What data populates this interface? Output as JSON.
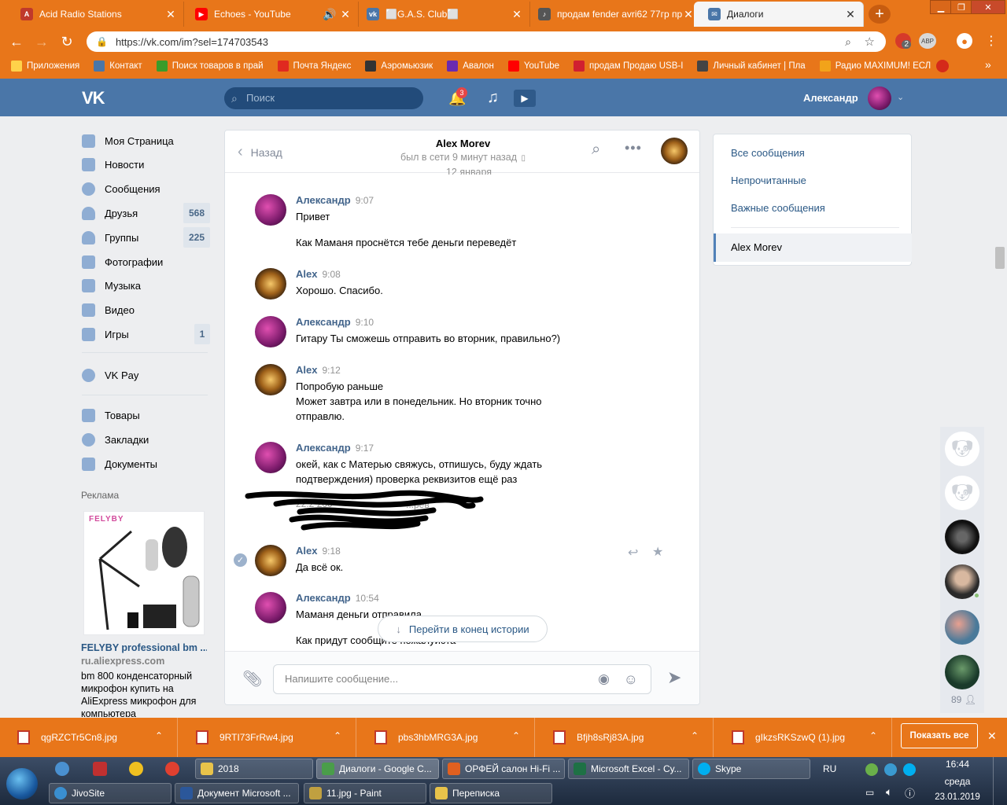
{
  "browser": {
    "tabs": [
      {
        "title": "Acid Radio Stations",
        "icon": "acid-radio-icon",
        "color": "#c0392b"
      },
      {
        "title": "Echoes - YouTube",
        "icon": "youtube-icon",
        "color": "#ff0000"
      },
      {
        "title": "⬜G.A.S. Club⬜",
        "icon": "vk-icon",
        "color": "#4a76a8"
      },
      {
        "title": "продам fender avri62 77гр пр...",
        "icon": "guitar-icon",
        "color": "#555555"
      },
      {
        "title": "Диалоги",
        "icon": "vk-dialog-icon",
        "color": "#4a76a8",
        "active": true
      }
    ],
    "url": "https://vk.com/im?sel=174703543",
    "extension_badge": "2",
    "extension_label": "АВР",
    "bookmarks": [
      {
        "label": "Приложения",
        "icon": "apps-grid-icon",
        "color": "#ffd24a"
      },
      {
        "label": "Контакт",
        "icon": "vk-icon",
        "color": "#4a76a8"
      },
      {
        "label": "Поиск товаров в прай",
        "icon": "leaf-icon",
        "color": "#3a9c2a"
      },
      {
        "label": "Почта Яндекс",
        "icon": "yandex-icon",
        "color": "#e02a20"
      },
      {
        "label": "Аэромьюзик",
        "icon": "aeromusic-icon",
        "color": "#333333"
      },
      {
        "label": "Авалон",
        "icon": "avalon-icon",
        "color": "#6a2ab0"
      },
      {
        "label": "YouTube",
        "icon": "youtube-icon",
        "color": "#ff0000"
      },
      {
        "label": "продам Продаю USB-I",
        "icon": "mf-icon",
        "color": "#d02030"
      },
      {
        "label": "Личный кабинет | Пла",
        "icon": "arrow-icon",
        "color": "#444444"
      },
      {
        "label": "Радио MAXIMUM! ЕСЛ",
        "icon": "radio-icon",
        "color": "#f2a31a"
      }
    ]
  },
  "vk": {
    "logo": "VK",
    "search_placeholder": "Поиск",
    "notifications_count": "3",
    "user_name": "Александр",
    "left_menu": [
      {
        "label": "Моя Страница",
        "icon": "home-icon"
      },
      {
        "label": "Новости",
        "icon": "news-icon"
      },
      {
        "label": "Сообщения",
        "icon": "messages-icon"
      },
      {
        "label": "Друзья",
        "icon": "friends-icon",
        "count": "568"
      },
      {
        "label": "Группы",
        "icon": "groups-icon",
        "count": "225"
      },
      {
        "label": "Фотографии",
        "icon": "camera-icon"
      },
      {
        "label": "Музыка",
        "icon": "music-icon"
      },
      {
        "label": "Видео",
        "icon": "video-icon"
      },
      {
        "label": "Игры",
        "icon": "games-icon",
        "count": "1"
      }
    ],
    "left_menu_2": [
      {
        "label": "VK Pay",
        "icon": "vkpay-icon"
      }
    ],
    "left_menu_3": [
      {
        "label": "Товары",
        "icon": "market-icon"
      },
      {
        "label": "Закладки",
        "icon": "star-icon"
      },
      {
        "label": "Документы",
        "icon": "document-icon"
      }
    ],
    "ad": {
      "heading": "Реклама",
      "brand": "FELYBY",
      "title": "FELYBY professional bm ...",
      "domain": "ru.aliexpress.com",
      "description": "bm 800 конденсаторный микрофон купить на AliExpress микрофон для компьютера"
    },
    "dialog": {
      "back_label": "Назад",
      "contact_name": "Alex Morev",
      "status": "был в сети 9 минут назад",
      "date_divider": "12 января",
      "messages": [
        {
          "author": "Александр",
          "time": "9:07",
          "avatar": "me",
          "lines": [
            "Привет",
            "",
            "Как Маманя проснётся тебе деньги переведёт"
          ]
        },
        {
          "author": "Alex",
          "time": "9:08",
          "avatar": "alex",
          "lines": [
            "Хорошо. Спасибо."
          ]
        },
        {
          "author": "Александр",
          "time": "9:10",
          "avatar": "me",
          "lines": [
            "Гитару Ты сможешь отправить во вторник, правильно?)"
          ]
        },
        {
          "author": "Alex",
          "time": "9:12",
          "avatar": "alex",
          "lines": [
            "Попробую раньше",
            "Может завтра или в понедельник. Но вторник точно отправлю."
          ]
        },
        {
          "author": "Александр",
          "time": "9:17",
          "avatar": "me",
          "lines": [
            "окей, как с Матерью свяжусь, отпишусь, буду ждать подтверждения) проверка реквизитов ещё раз"
          ]
        },
        {
          "author": "Alex",
          "time": "9:18",
          "avatar": "alex",
          "lines": [
            "Да всё ок."
          ]
        },
        {
          "author": "Александр",
          "time": "10:54",
          "avatar": "me",
          "lines": [
            "Маманя деньги отправила",
            "",
            "Как придут сообщите пожалуйста"
          ]
        }
      ],
      "redacted_fragment": "...рев",
      "redacted_fragment_2": "22.2 200",
      "goto_end": "Перейти в конец истории",
      "input_placeholder": "Напишите сообщение..."
    },
    "right_menu": {
      "items": [
        "Все сообщения",
        "Непрочитанные",
        "Важные сообщения"
      ],
      "selected": "Alex Morev"
    },
    "sidebar_count": "89"
  },
  "downloads": {
    "files": [
      "qgRZCTr5Cn8.jpg",
      "9RTI73FrRw4.jpg",
      "pbs3hbMRG3A.jpg",
      "Bfjh8sRj83A.jpg",
      "gIkzsRKSzwQ (1).jpg"
    ],
    "show_all": "Показать все"
  },
  "taskbar": {
    "row1": [
      {
        "label": "2018",
        "icon": "folder-icon",
        "color": "#e8c34a"
      },
      {
        "label": "Диалоги - Google C...",
        "icon": "chrome-icon",
        "color": "#4a9d4a"
      },
      {
        "label": "ОРФЕЙ салон Hi-Fi ...",
        "icon": "firefox-icon",
        "color": "#e06020"
      },
      {
        "label": "Microsoft Excel - Су...",
        "icon": "excel-icon",
        "color": "#1e7145"
      },
      {
        "label": "Skype",
        "icon": "skype-icon",
        "color": "#00aff0"
      }
    ],
    "row2": [
      {
        "label": "JivoSite",
        "icon": "jivosite-icon",
        "color": "#3a8fd0"
      },
      {
        "label": "Документ Microsoft ...",
        "icon": "word-icon",
        "color": "#2b579a"
      },
      {
        "label": "11.jpg - Paint",
        "icon": "paint-icon",
        "color": "#c0a040"
      },
      {
        "label": "Переписка",
        "icon": "folder-icon",
        "color": "#e8c34a"
      }
    ],
    "lang": "RU",
    "time": "16:44",
    "day": "среда",
    "date": "23.01.2019"
  }
}
